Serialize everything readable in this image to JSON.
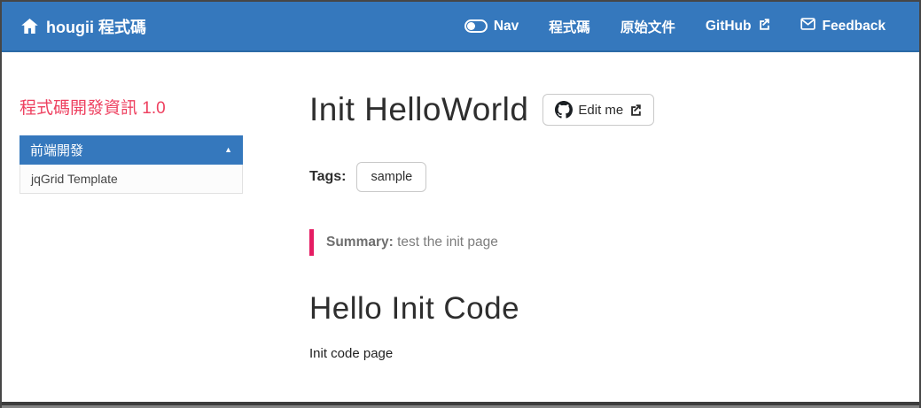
{
  "navbar": {
    "brand": "hougii 程式碼",
    "items": [
      {
        "label": "Nav",
        "icon": "toggle-icon"
      },
      {
        "label": "程式碼"
      },
      {
        "label": "原始文件"
      },
      {
        "label": "GitHub",
        "icon_after": "external-link-icon"
      },
      {
        "label": "Feedback",
        "icon": "envelope-icon"
      }
    ]
  },
  "sidebar": {
    "title": "程式碼開發資訊 1.0",
    "accordion": {
      "header": "前端開發",
      "state_icon": "triangle-up-icon",
      "items": [
        {
          "label": "jqGrid Template"
        }
      ]
    }
  },
  "main": {
    "page_title": "Init HelloWorld",
    "edit_button_label": "Edit me",
    "tags_label": "Tags:",
    "tags": [
      {
        "label": "sample"
      }
    ],
    "summary_label": "Summary:",
    "summary_text": "test the init page",
    "section_heading": "Hello Init Code",
    "body_text": "Init code page"
  },
  "colors": {
    "navbar_blue": "#3578bd",
    "navbar_border": "#2b6aa6",
    "sidebar_title_pink": "#ee4160",
    "summary_bar_pink": "#e51d63",
    "text_dark": "#2e2e2e",
    "summary_gray": "#7d7d7d",
    "frame_border": "#464646"
  }
}
